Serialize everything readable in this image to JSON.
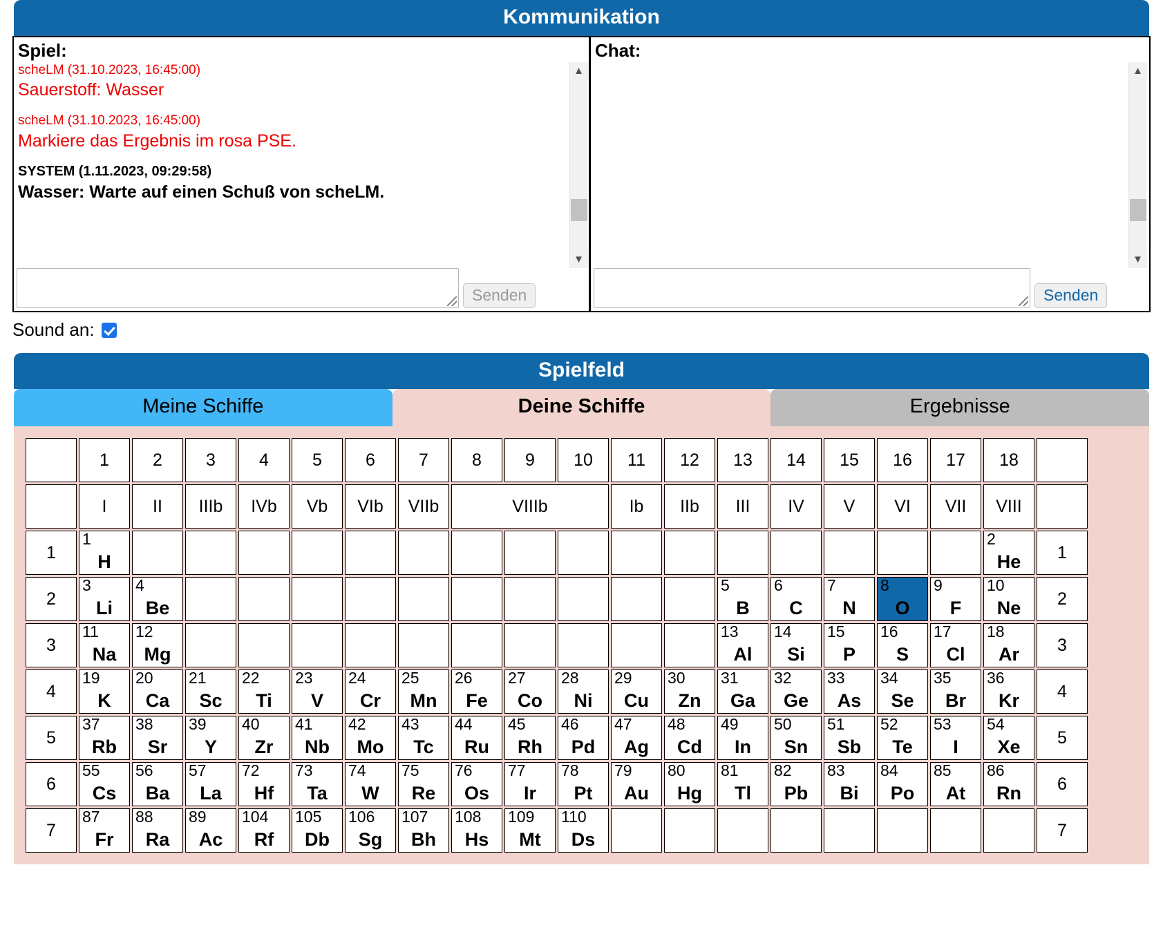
{
  "communication": {
    "title": "Kommunikation",
    "game": {
      "label": "Spiel:",
      "messages": [
        {
          "meta": "scheLM (31.10.2023, 16:45:00)",
          "text": "Sauerstoff: Wasser",
          "style": "red"
        },
        {
          "meta": "scheLM (31.10.2023, 16:45:00)",
          "text": "Markiere das Ergebnis im rosa PSE.",
          "style": "red"
        },
        {
          "meta": "SYSTEM (1.11.2023, 09:29:58)",
          "text": "Wasser: Warte auf einen Schuß von scheLM.",
          "style": "sys"
        }
      ],
      "input_value": "",
      "send_label": "Senden"
    },
    "chat": {
      "label": "Chat:",
      "messages": [],
      "input_value": "",
      "send_label": "Senden"
    }
  },
  "sound": {
    "label": "Sound an:",
    "checked": true
  },
  "spielfeld": {
    "title": "Spielfeld",
    "tabs": [
      {
        "label": "Meine Schiffe",
        "active": false,
        "color": "#43b6f7"
      },
      {
        "label": "Deine Schiffe",
        "active": true,
        "color": "#f2d3cd"
      },
      {
        "label": "Ergebnisse",
        "active": false,
        "color": "#bcbcbc"
      }
    ]
  },
  "pse": {
    "group_numbers": [
      "1",
      "2",
      "3",
      "4",
      "5",
      "6",
      "7",
      "8",
      "9",
      "10",
      "11",
      "12",
      "13",
      "14",
      "15",
      "16",
      "17",
      "18"
    ],
    "roman_groups": [
      {
        "label": "I",
        "span": 1
      },
      {
        "label": "II",
        "span": 1
      },
      {
        "label": "IIIb",
        "span": 1
      },
      {
        "label": "IVb",
        "span": 1
      },
      {
        "label": "Vb",
        "span": 1
      },
      {
        "label": "VIb",
        "span": 1
      },
      {
        "label": "VIIb",
        "span": 1
      },
      {
        "label": "VIIIb",
        "span": 3
      },
      {
        "label": "Ib",
        "span": 1
      },
      {
        "label": "IIb",
        "span": 1
      },
      {
        "label": "III",
        "span": 1
      },
      {
        "label": "IV",
        "span": 1
      },
      {
        "label": "V",
        "span": 1
      },
      {
        "label": "VI",
        "span": 1
      },
      {
        "label": "VII",
        "span": 1
      },
      {
        "label": "VIII",
        "span": 1
      }
    ],
    "periods": [
      "1",
      "2",
      "3",
      "4",
      "5",
      "6",
      "7"
    ],
    "highlight_color": "#1068a8",
    "background_color": "#f2d3cd",
    "rows": [
      {
        "period": "1",
        "cells": [
          {
            "n": "1",
            "s": "H"
          },
          null,
          null,
          null,
          null,
          null,
          null,
          null,
          null,
          null,
          null,
          null,
          null,
          null,
          null,
          null,
          null,
          {
            "n": "2",
            "s": "He"
          }
        ]
      },
      {
        "period": "2",
        "cells": [
          {
            "n": "3",
            "s": "Li"
          },
          {
            "n": "4",
            "s": "Be"
          },
          null,
          null,
          null,
          null,
          null,
          null,
          null,
          null,
          null,
          null,
          {
            "n": "5",
            "s": "B"
          },
          {
            "n": "6",
            "s": "C"
          },
          {
            "n": "7",
            "s": "N"
          },
          {
            "n": "8",
            "s": "O",
            "hit": true
          },
          {
            "n": "9",
            "s": "F"
          },
          {
            "n": "10",
            "s": "Ne"
          }
        ]
      },
      {
        "period": "3",
        "cells": [
          {
            "n": "11",
            "s": "Na"
          },
          {
            "n": "12",
            "s": "Mg"
          },
          null,
          null,
          null,
          null,
          null,
          null,
          null,
          null,
          null,
          null,
          {
            "n": "13",
            "s": "Al"
          },
          {
            "n": "14",
            "s": "Si"
          },
          {
            "n": "15",
            "s": "P"
          },
          {
            "n": "16",
            "s": "S"
          },
          {
            "n": "17",
            "s": "Cl"
          },
          {
            "n": "18",
            "s": "Ar"
          }
        ]
      },
      {
        "period": "4",
        "cells": [
          {
            "n": "19",
            "s": "K"
          },
          {
            "n": "20",
            "s": "Ca"
          },
          {
            "n": "21",
            "s": "Sc"
          },
          {
            "n": "22",
            "s": "Ti"
          },
          {
            "n": "23",
            "s": "V"
          },
          {
            "n": "24",
            "s": "Cr"
          },
          {
            "n": "25",
            "s": "Mn"
          },
          {
            "n": "26",
            "s": "Fe"
          },
          {
            "n": "27",
            "s": "Co"
          },
          {
            "n": "28",
            "s": "Ni"
          },
          {
            "n": "29",
            "s": "Cu"
          },
          {
            "n": "30",
            "s": "Zn"
          },
          {
            "n": "31",
            "s": "Ga"
          },
          {
            "n": "32",
            "s": "Ge"
          },
          {
            "n": "33",
            "s": "As"
          },
          {
            "n": "34",
            "s": "Se"
          },
          {
            "n": "35",
            "s": "Br"
          },
          {
            "n": "36",
            "s": "Kr"
          }
        ]
      },
      {
        "period": "5",
        "cells": [
          {
            "n": "37",
            "s": "Rb"
          },
          {
            "n": "38",
            "s": "Sr"
          },
          {
            "n": "39",
            "s": "Y"
          },
          {
            "n": "40",
            "s": "Zr"
          },
          {
            "n": "41",
            "s": "Nb"
          },
          {
            "n": "42",
            "s": "Mo"
          },
          {
            "n": "43",
            "s": "Tc"
          },
          {
            "n": "44",
            "s": "Ru"
          },
          {
            "n": "45",
            "s": "Rh"
          },
          {
            "n": "46",
            "s": "Pd"
          },
          {
            "n": "47",
            "s": "Ag"
          },
          {
            "n": "48",
            "s": "Cd"
          },
          {
            "n": "49",
            "s": "In"
          },
          {
            "n": "50",
            "s": "Sn"
          },
          {
            "n": "51",
            "s": "Sb"
          },
          {
            "n": "52",
            "s": "Te"
          },
          {
            "n": "53",
            "s": "I"
          },
          {
            "n": "54",
            "s": "Xe"
          }
        ]
      },
      {
        "period": "6",
        "cells": [
          {
            "n": "55",
            "s": "Cs"
          },
          {
            "n": "56",
            "s": "Ba"
          },
          {
            "n": "57",
            "s": "La"
          },
          {
            "n": "72",
            "s": "Hf"
          },
          {
            "n": "73",
            "s": "Ta"
          },
          {
            "n": "74",
            "s": "W"
          },
          {
            "n": "75",
            "s": "Re"
          },
          {
            "n": "76",
            "s": "Os"
          },
          {
            "n": "77",
            "s": "Ir"
          },
          {
            "n": "78",
            "s": "Pt"
          },
          {
            "n": "79",
            "s": "Au"
          },
          {
            "n": "80",
            "s": "Hg"
          },
          {
            "n": "81",
            "s": "Tl"
          },
          {
            "n": "82",
            "s": "Pb"
          },
          {
            "n": "83",
            "s": "Bi"
          },
          {
            "n": "84",
            "s": "Po"
          },
          {
            "n": "85",
            "s": "At"
          },
          {
            "n": "86",
            "s": "Rn"
          }
        ]
      },
      {
        "period": "7",
        "cells": [
          {
            "n": "87",
            "s": "Fr"
          },
          {
            "n": "88",
            "s": "Ra"
          },
          {
            "n": "89",
            "s": "Ac"
          },
          {
            "n": "104",
            "s": "Rf"
          },
          {
            "n": "105",
            "s": "Db"
          },
          {
            "n": "106",
            "s": "Sg"
          },
          {
            "n": "107",
            "s": "Bh"
          },
          {
            "n": "108",
            "s": "Hs"
          },
          {
            "n": "109",
            "s": "Mt"
          },
          {
            "n": "110",
            "s": "Ds"
          },
          null,
          null,
          null,
          null,
          null,
          null,
          null,
          null
        ]
      }
    ]
  }
}
